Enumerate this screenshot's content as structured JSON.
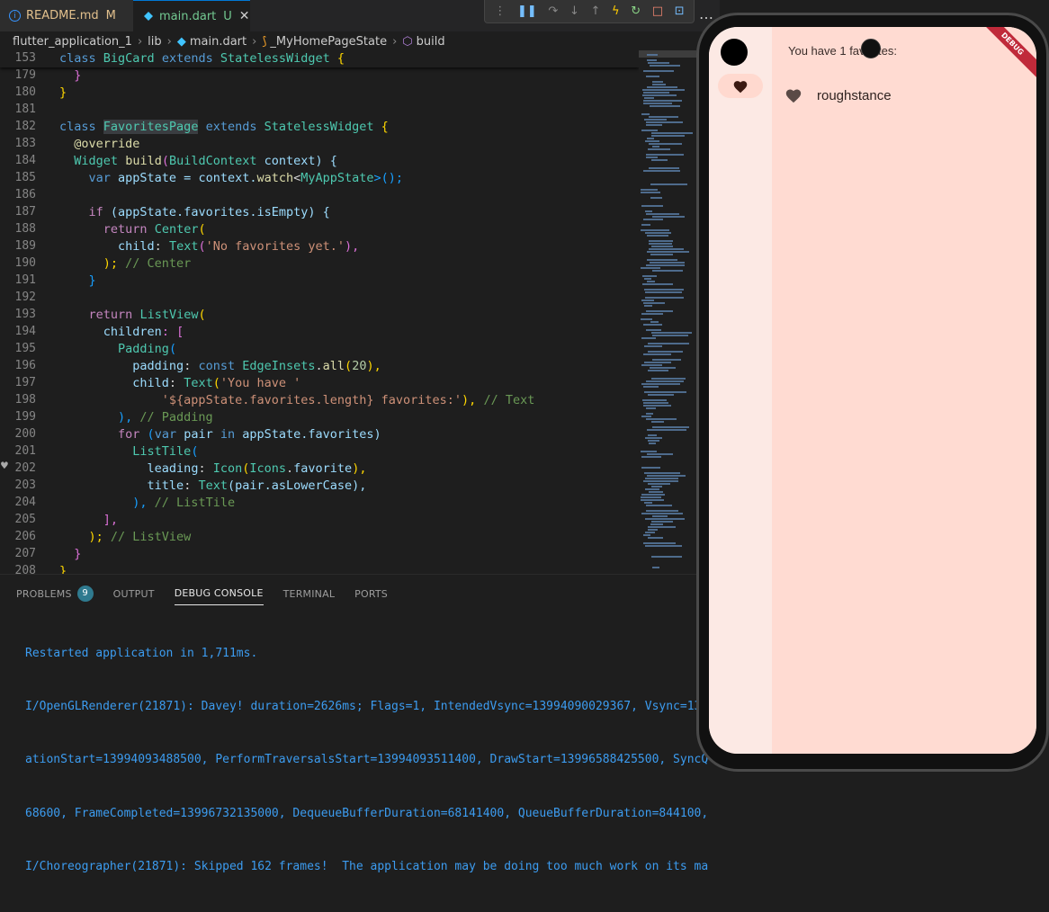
{
  "tabs": [
    {
      "label": "README.md",
      "status": "M"
    },
    {
      "label": "main.dart",
      "status": "U"
    }
  ],
  "breadcrumb": [
    "flutter_application_1",
    "lib",
    "main.dart",
    "_MyHomePageState",
    "build"
  ],
  "gutter": [
    "153",
    "179",
    "180",
    "181",
    "182",
    "183",
    "184",
    "185",
    "186",
    "187",
    "188",
    "189",
    "190",
    "191",
    "192",
    "193",
    "194",
    "195",
    "196",
    "197",
    "198",
    "199",
    "200",
    "201",
    "202",
    "203",
    "204",
    "205",
    "206",
    "207",
    "208"
  ],
  "code": {
    "l153": [
      "class ",
      "BigCard",
      " extends ",
      "StatelessWidget",
      " {"
    ],
    "l179": [
      "  }"
    ],
    "l180": [
      "}"
    ],
    "l182": [
      "class ",
      "FavoritesPage",
      " extends ",
      "StatelessWidget",
      " {"
    ],
    "l183": [
      "  @override"
    ],
    "l184": [
      "  ",
      "Widget",
      " ",
      "build",
      "(",
      "BuildContext",
      " context) {"
    ],
    "l185": [
      "    ",
      "var",
      " appState = context.",
      "watch",
      "<",
      "MyAppState",
      ">();"
    ],
    "l187": [
      "    ",
      "if",
      " (appState.favorites.isEmpty) {"
    ],
    "l188": [
      "      ",
      "return",
      " ",
      "Center",
      "("
    ],
    "l189": [
      "        ",
      "child",
      ": ",
      "Text",
      "(",
      "'No favorites yet.'",
      "),"
    ],
    "l190": [
      "      ); ",
      "// Center"
    ],
    "l191": [
      "    }"
    ],
    "l193": [
      "    ",
      "return",
      " ",
      "ListView",
      "("
    ],
    "l194": [
      "      ",
      "children",
      ": ["
    ],
    "l195": [
      "        ",
      "Padding",
      "("
    ],
    "l196": [
      "          ",
      "padding",
      ": ",
      "const",
      " ",
      "EdgeInsets",
      ".",
      "all",
      "(",
      "20",
      "),"
    ],
    "l197": [
      "          ",
      "child",
      ": ",
      "Text",
      "(",
      "'You have '"
    ],
    "l198": [
      "              ",
      "'${appState.favorites.length} favorites:'",
      "), ",
      "// Text"
    ],
    "l199": [
      "        ), ",
      "// Padding"
    ],
    "l200": [
      "        ",
      "for",
      " (",
      "var",
      " pair ",
      "in",
      " appState.favorites)"
    ],
    "l201": [
      "          ",
      "ListTile",
      "("
    ],
    "l202": [
      "            ",
      "leading",
      ": ",
      "Icon",
      "(",
      "Icons",
      ".",
      "favorite",
      "),"
    ],
    "l203": [
      "            ",
      "title",
      ": ",
      "Text",
      "(pair.asLowerCase),"
    ],
    "l204": [
      "          ), ",
      "// ListTile"
    ],
    "l205": [
      "      ],"
    ],
    "l206": [
      "    ); ",
      "// ListView"
    ],
    "l207": [
      "  }"
    ],
    "l208": [
      "}"
    ]
  },
  "panel": {
    "tabs": [
      "PROBLEMS",
      "OUTPUT",
      "DEBUG CONSOLE",
      "TERMINAL",
      "PORTS"
    ],
    "problems_count": "9",
    "active_tab": "DEBUG CONSOLE",
    "console_lines": [
      "Restarted application in 1,711ms.",
      "I/OpenGLRenderer(21871): Davey! duration=2626ms; Flags=1, IntendedVsync=13994090029367, Vsync=139",
      "ationStart=13994093488500, PerformTraversalsStart=13994093511400, DrawStart=13996588425500, SyncQ",
      "68600, FrameCompleted=13996732135000, DequeueBufferDuration=68141400, QueueBufferDuration=844100,",
      "I/Choreographer(21871): Skipped 162 frames!  The application may be doing too much work on its ma"
    ]
  },
  "phone": {
    "debug_banner": "DEBUG",
    "favorites_header": "You have 1 favorites:",
    "favorites": [
      "roughstance"
    ]
  },
  "colors": {
    "screen_bg": "#ffdbd2",
    "rail_bg": "#fce9e4",
    "console_text": "#3c9cf0"
  }
}
